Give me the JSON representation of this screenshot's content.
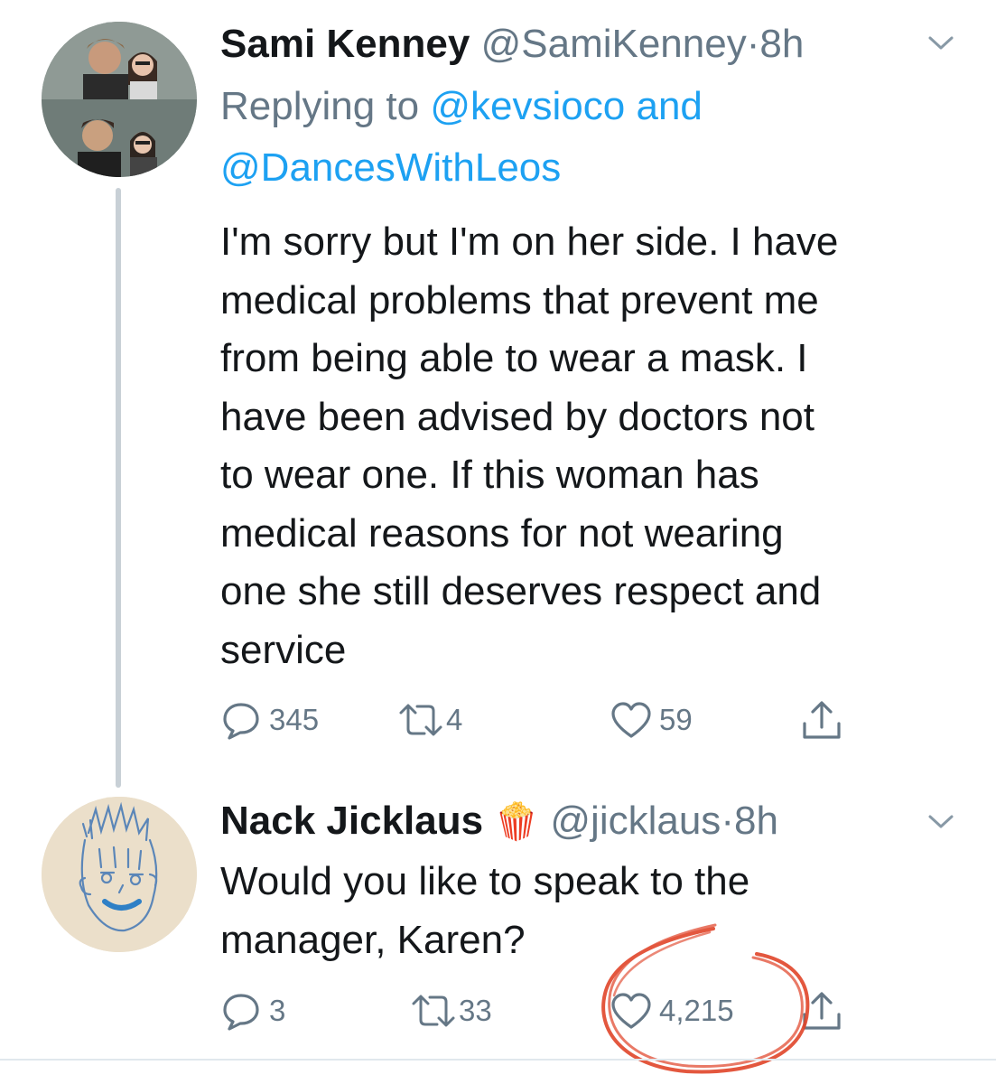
{
  "tweets": [
    {
      "name": "Sami Kenney",
      "handle": "@SamiKenney",
      "separator": "·",
      "time": "8h",
      "replying_prefix": "Replying to",
      "replying_handle_1": "@kevsioco",
      "replying_and": "and",
      "replying_handle_2": "@DancesWithLeos",
      "text_lines": [
        "I'm sorry but I'm on her side. I have",
        "medical problems that prevent me",
        "from being able to wear a mask. I",
        "have been advised by doctors not",
        "to wear one. If this woman has",
        "medical reasons for not wearing",
        "one she still deserves respect and",
        "service"
      ],
      "replies": "345",
      "retweets": "4",
      "likes": "59"
    },
    {
      "name": "Nack Jicklaus",
      "emoji": "🍿",
      "handle": "@jicklaus",
      "separator": "·",
      "time": "8h",
      "text_lines": [
        "Would you like to speak to the",
        "manager, Karen?"
      ],
      "replies": "3",
      "retweets": "33",
      "likes": "4,215"
    }
  ],
  "colors": {
    "text": "#14171a",
    "secondary": "#657786",
    "link": "#1da1f2",
    "annotation": "#e0452a"
  }
}
